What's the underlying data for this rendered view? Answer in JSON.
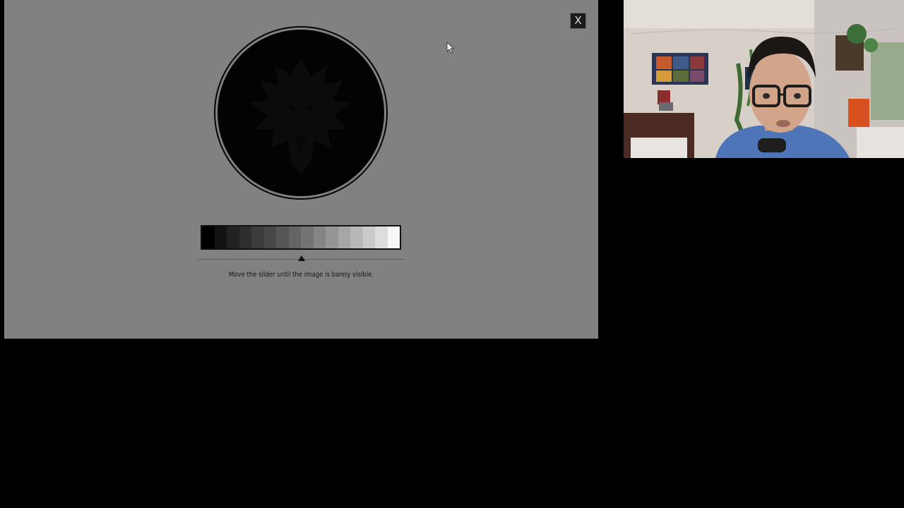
{
  "close_button": {
    "label": "X"
  },
  "gray_scale": {
    "swatches": [
      "#000000",
      "#121212",
      "#222222",
      "#2e2e2e",
      "#3b3b3b",
      "#474747",
      "#565656",
      "#646464",
      "#737373",
      "#858585",
      "#959595",
      "#a6a6a6",
      "#b8b8b8",
      "#cacaca",
      "#dddddd",
      "#f7f7f7"
    ]
  },
  "slider": {
    "level": 0.5
  },
  "instruction": {
    "text": "Move the slider until the image is barely visible."
  },
  "colors": {
    "window_background": "#818181",
    "emblem_disc": "#030303",
    "emblem_faint": "#0a0a0a"
  }
}
